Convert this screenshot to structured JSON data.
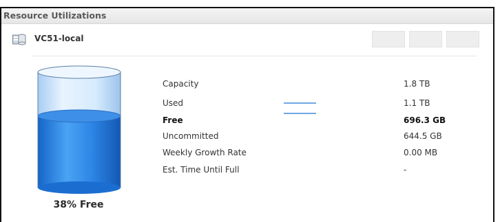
{
  "panel": {
    "title": "Resource Utilizations"
  },
  "source": {
    "icon": "database-icon",
    "name": "VC51-local"
  },
  "gauge": {
    "free_fraction": 0.38,
    "free_label": "38% Free"
  },
  "metrics": [
    {
      "label": "Capacity",
      "value": "1.8 TB"
    },
    {
      "label": "Used",
      "value": "1.1 TB"
    },
    {
      "label": "Free",
      "value": "696.3 GB"
    },
    {
      "label": "Uncommitted",
      "value": "644.5 GB"
    },
    {
      "label": "Weekly Growth Rate",
      "value": "0.00 MB"
    },
    {
      "label": "Est. Time Until Full",
      "value": "-"
    }
  ],
  "colors": {
    "used_line": "#6fa8e6",
    "free_line": "#6fa8e6",
    "liquid": "#2e7fdf",
    "glass": "#cfe6fb"
  }
}
